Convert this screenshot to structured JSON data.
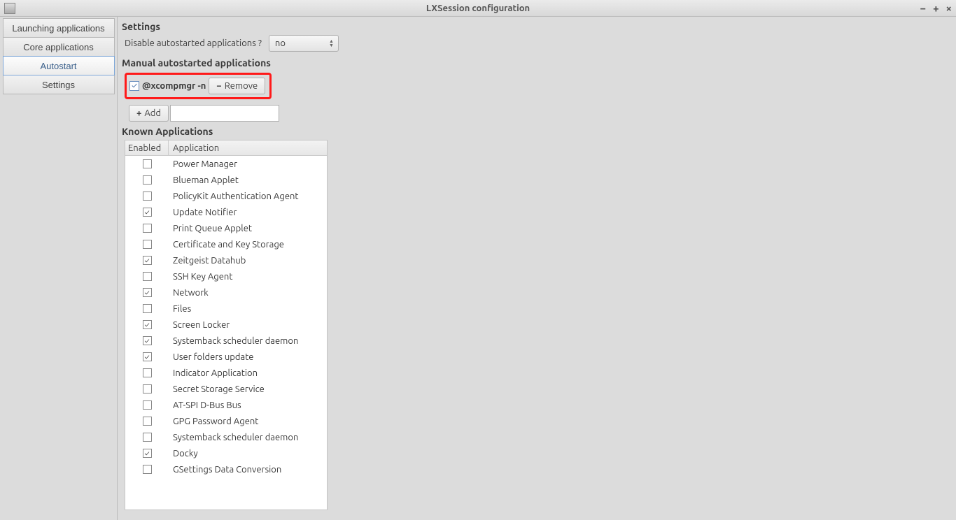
{
  "window": {
    "title": "LXSession configuration"
  },
  "sidebar": {
    "items": [
      {
        "label": "Launching applications",
        "selected": false
      },
      {
        "label": "Core applications",
        "selected": false
      },
      {
        "label": "Autostart",
        "selected": true
      },
      {
        "label": "Settings",
        "selected": false
      }
    ]
  },
  "settings": {
    "heading": "Settings",
    "disable_label": "Disable autostarted applications ?",
    "disable_value": "no"
  },
  "manual": {
    "heading": "Manual autostarted applications",
    "entry": "@xcompmgr -n",
    "entry_checked": true,
    "remove_label": "Remove",
    "add_label": "Add",
    "add_value": ""
  },
  "known": {
    "heading": "Known Applications",
    "col_enabled": "Enabled",
    "col_app": "Application",
    "rows": [
      {
        "enabled": false,
        "name": "Power Manager"
      },
      {
        "enabled": false,
        "name": "Blueman Applet"
      },
      {
        "enabled": false,
        "name": "PolicyKit Authentication Agent"
      },
      {
        "enabled": true,
        "name": "Update Notifier"
      },
      {
        "enabled": false,
        "name": "Print Queue Applet"
      },
      {
        "enabled": false,
        "name": "Certificate and Key Storage"
      },
      {
        "enabled": true,
        "name": "Zeitgeist Datahub"
      },
      {
        "enabled": false,
        "name": "SSH Key Agent"
      },
      {
        "enabled": true,
        "name": "Network"
      },
      {
        "enabled": false,
        "name": "Files"
      },
      {
        "enabled": true,
        "name": "Screen Locker"
      },
      {
        "enabled": true,
        "name": "Systemback scheduler daemon"
      },
      {
        "enabled": true,
        "name": "User folders update"
      },
      {
        "enabled": false,
        "name": "Indicator Application"
      },
      {
        "enabled": false,
        "name": "Secret Storage Service"
      },
      {
        "enabled": false,
        "name": "AT-SPI D-Bus Bus"
      },
      {
        "enabled": false,
        "name": "GPG Password Agent"
      },
      {
        "enabled": false,
        "name": "Systemback scheduler daemon"
      },
      {
        "enabled": true,
        "name": "Docky"
      },
      {
        "enabled": false,
        "name": "GSettings Data Conversion"
      }
    ]
  }
}
